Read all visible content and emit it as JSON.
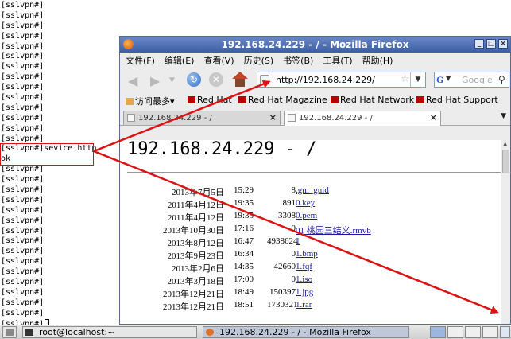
{
  "terminal": {
    "lines_top": [
      "[sslvpn#]",
      "[sslvpn#]",
      "[sslvpn#]",
      "[sslvpn#]",
      "[sslvpn#]",
      "[sslvpn#]",
      "[sslvpn#]",
      "[sslvpn#]",
      "[sslvpn#]",
      "[sslvpn#]",
      "[sslvpn#]",
      "[sslvpn#]",
      "[sslvpn#]",
      "[sslvpn#]"
    ],
    "command_line": "[sslvpn#]sevice http",
    "output_line": "ok",
    "lines_bottom": [
      "[sslvpn#]",
      "[sslvpn#]",
      "[sslvpn#]",
      "[sslvpn#]",
      "[sslvpn#]",
      "[sslvpn#]",
      "[sslvpn#]",
      "[sslvpn#]",
      "[sslvpn#]",
      "[sslvpn#]",
      "[sslvpn#]",
      "[sslvpn#]",
      "[sslvpn#]",
      "[sslvpn#]",
      "[sslvpn#]"
    ],
    "prompt_last": "[sslvpn#]"
  },
  "firefox": {
    "title": "192.168.24.229 - / - Mozilla Firefox",
    "window_buttons": [
      "_",
      "□",
      "×"
    ],
    "menu": [
      "文件(F)",
      "编辑(E)",
      "查看(V)",
      "历史(S)",
      "书签(B)",
      "工具(T)",
      "帮助(H)"
    ],
    "url": "http://192.168.24.229/",
    "search_placeholder": "Google",
    "search_engine_letter": "G",
    "bookmarks": [
      {
        "label": "访问最多",
        "dropdown": "▾"
      },
      {
        "label": "Red Hat"
      },
      {
        "label": "Red Hat Magazine"
      },
      {
        "label": "Red Hat Network"
      },
      {
        "label": "Red Hat Support"
      }
    ],
    "tabs": [
      {
        "label": "192.168.24.229 - /",
        "close": "×"
      },
      {
        "label": "192.168.24.229 - /",
        "close": "×"
      }
    ],
    "page": {
      "heading": "192.168.24.229 - /",
      "files": [
        {
          "date": "2013年7月5日",
          "time": "15:29",
          "size": "8",
          "name": ".gm_guid"
        },
        {
          "date": "2011年4月12日",
          "time": "19:35",
          "size": "891",
          "name": "0.key"
        },
        {
          "date": "2011年4月12日",
          "time": "19:35",
          "size": "3308",
          "name": "0.pem"
        },
        {
          "date": "2013年10月30日",
          "time": "17:16",
          "size": "0",
          "name": "01 桃园三结义.rmvb"
        },
        {
          "date": "2013年8月12日",
          "time": "16:47",
          "size": "4938624",
          "name": "1"
        },
        {
          "date": "2013年9月23日",
          "time": "16:34",
          "size": "0",
          "name": "1.bmp"
        },
        {
          "date": "2013年2月6日",
          "time": "14:35",
          "size": "42660",
          "name": "1.fqf"
        },
        {
          "date": "2013年3月18日",
          "time": "17:00",
          "size": "0",
          "name": "1.iso"
        },
        {
          "date": "2013年12月21日",
          "time": "18:49",
          "size": "150397",
          "name": "1.jpg"
        },
        {
          "date": "2013年12月21日",
          "time": "18:51",
          "size": "1730321",
          "name": "1.rar"
        }
      ]
    }
  },
  "taskbar": {
    "items": [
      {
        "label": "root@localhost:~"
      },
      {
        "label": "192.168.24.229 - / - Mozilla Firefox"
      }
    ]
  },
  "colors": {
    "annotation_red": "#dd1111",
    "title_blue": "#3c5ea4",
    "link_blue": "#1a1aa6"
  }
}
